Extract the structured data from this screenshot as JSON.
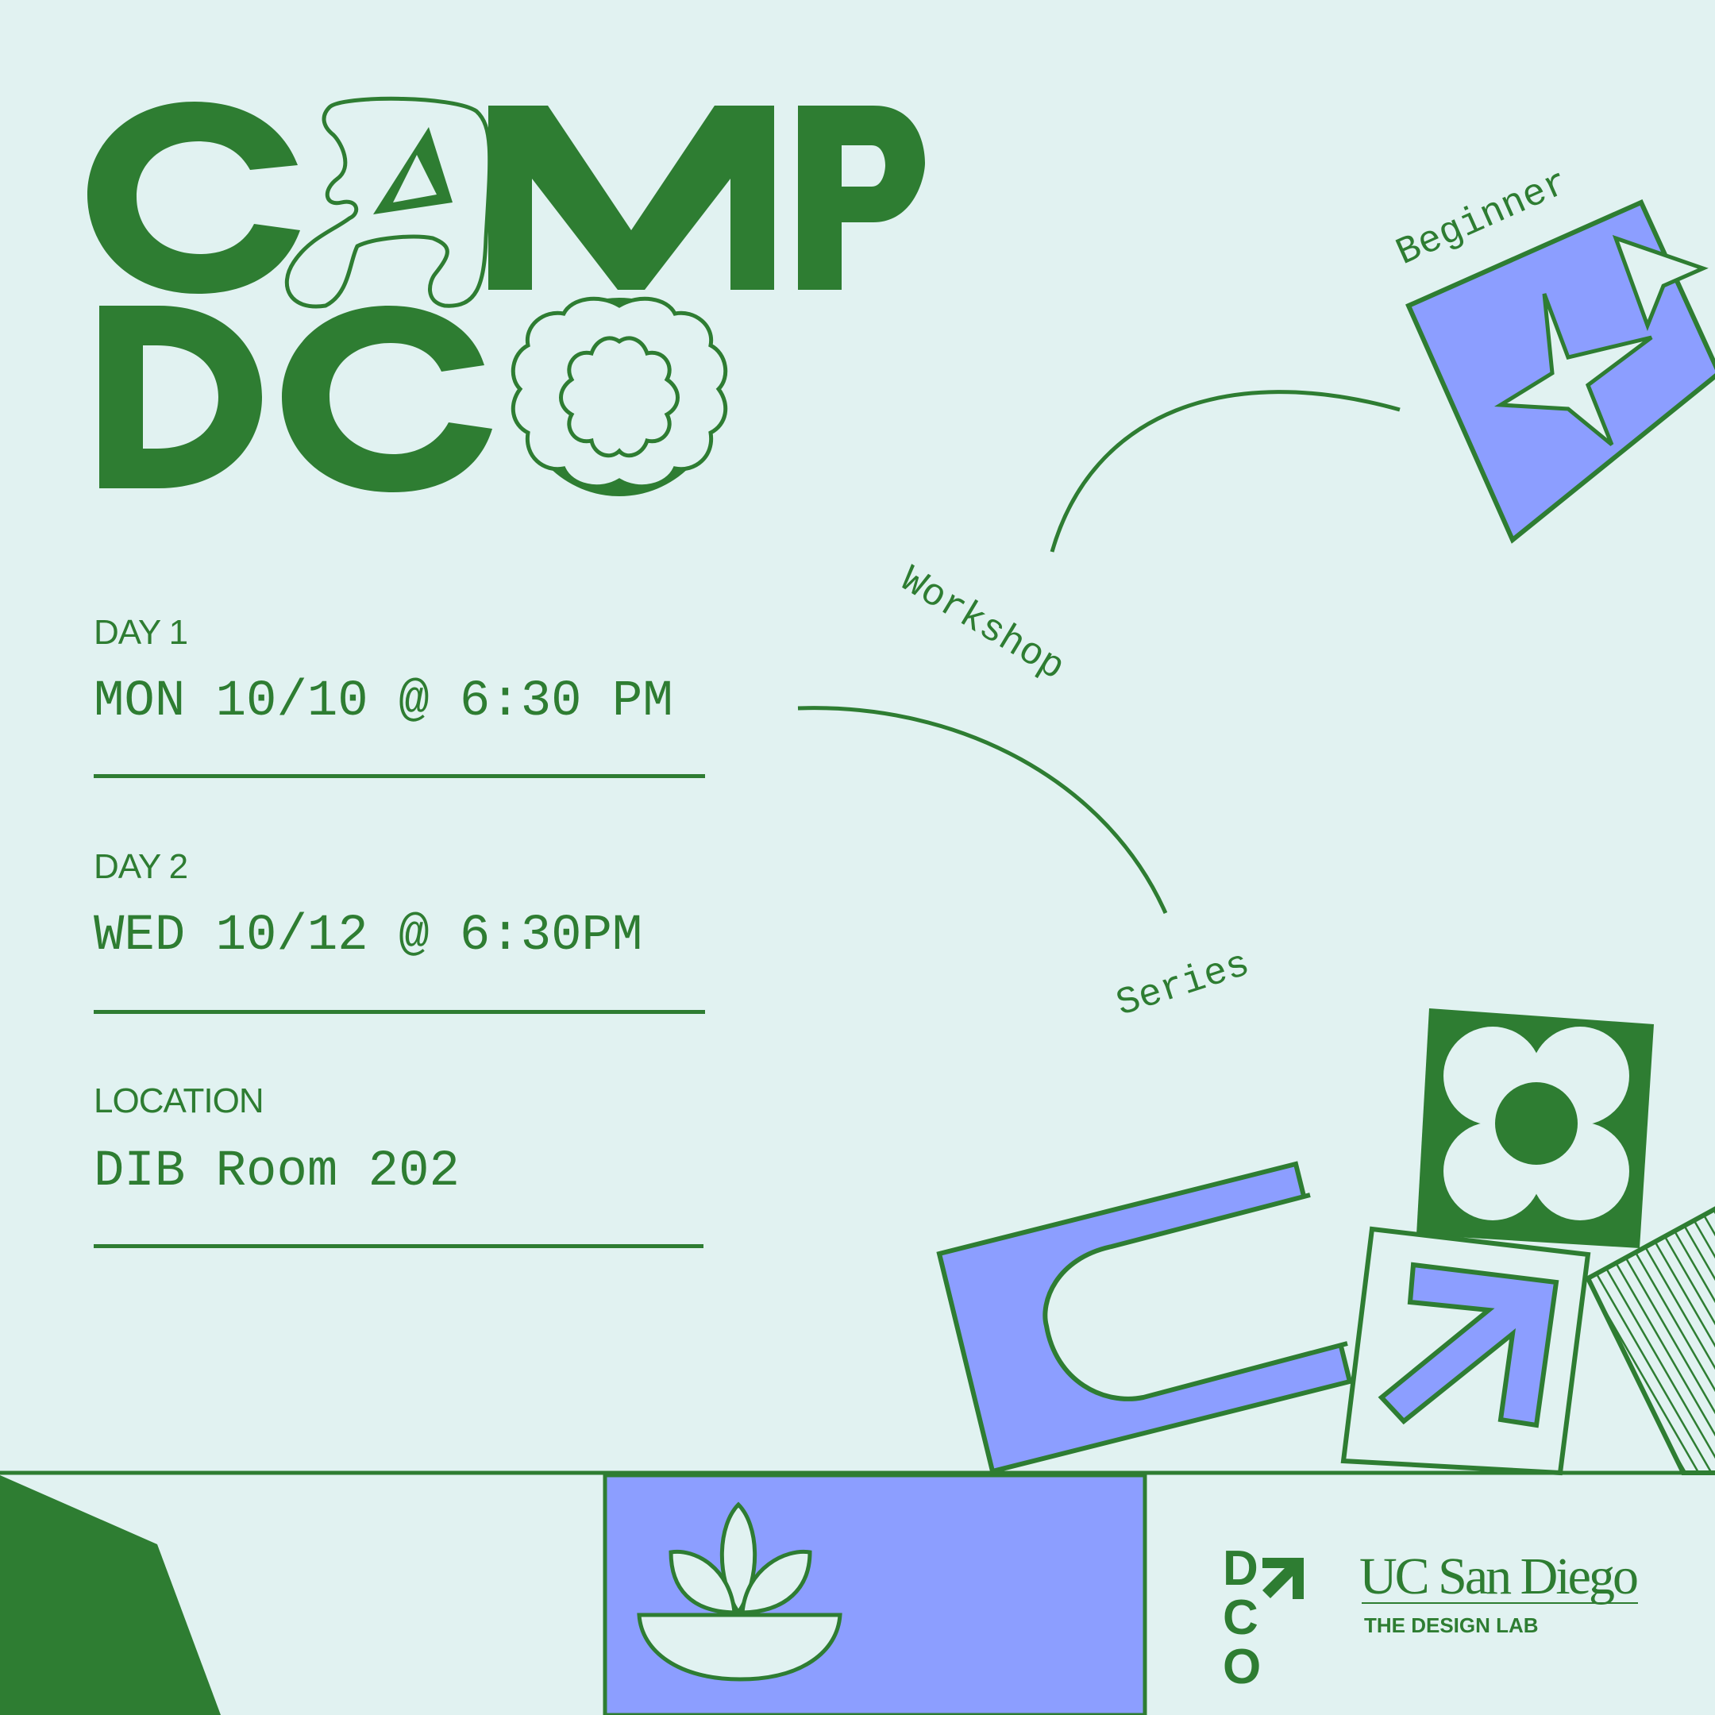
{
  "colors": {
    "background": "#e1f2f1",
    "green": "#2e7d32",
    "periwinkle": "#8c9eff"
  },
  "title": {
    "line1": "CAMP",
    "line2": "DCO"
  },
  "tags": {
    "workshop": "Workshop",
    "series": "Series",
    "beginner": "Beginner"
  },
  "schedule": {
    "day1": {
      "label": "DAY 1",
      "value": "MON 10/10 @ 6:30 PM"
    },
    "day2": {
      "label": "DAY 2",
      "value": "WED 10/12 @ 6:30PM"
    },
    "location": {
      "label": "LOCATION",
      "value": "DIB Room 202"
    }
  },
  "footer": {
    "dco_logo": "DCO",
    "ucsd": "UC San Diego",
    "design_lab": "THE DESIGN LAB"
  },
  "icons": [
    "star-icon",
    "cursor-icon",
    "flower-icon",
    "arrow-icon",
    "lotus-icon",
    "pill-icon",
    "daisy-icon"
  ]
}
